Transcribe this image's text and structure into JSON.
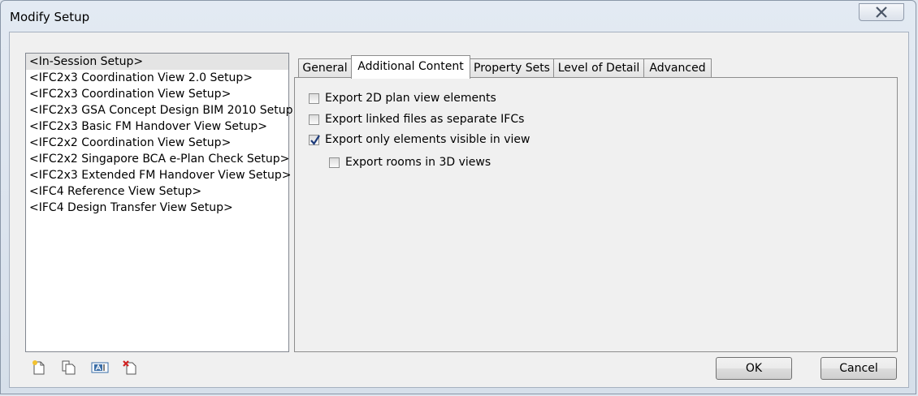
{
  "window": {
    "title": "Modify Setup"
  },
  "setups": [
    "<In-Session Setup>",
    "<IFC2x3 Coordination View 2.0 Setup>",
    "<IFC2x3 Coordination View Setup>",
    "<IFC2x3 GSA Concept Design BIM 2010 Setup>",
    "<IFC2x3 Basic FM Handover View Setup>",
    "<IFC2x2 Coordination View Setup>",
    "<IFC2x2 Singapore BCA e-Plan Check Setup>",
    "<IFC2x3 Extended FM Handover View Setup>",
    "<IFC4 Reference View Setup>",
    "<IFC4 Design Transfer View Setup>"
  ],
  "tabs": [
    {
      "label": "General"
    },
    {
      "label": "Additional Content"
    },
    {
      "label": "Property Sets"
    },
    {
      "label": "Level of Detail"
    },
    {
      "label": "Advanced"
    }
  ],
  "active_tab": "Additional Content",
  "options": [
    {
      "label": "Export 2D plan view elements",
      "checked": false
    },
    {
      "label": "Export linked files as separate IFCs",
      "checked": false
    },
    {
      "label": "Export only elements visible in view",
      "checked": true
    },
    {
      "label": "Export rooms in 3D views",
      "checked": false
    }
  ],
  "toolbar": {
    "icons": [
      "new-setup-icon",
      "duplicate-setup-icon",
      "rename-setup-icon",
      "delete-setup-icon"
    ]
  },
  "buttons": {
    "ok": "OK",
    "cancel": "Cancel"
  },
  "colors": {
    "selected_item_bg": "#e4e4e4",
    "close_x": "#4a5566",
    "check": "#1c3a7a"
  }
}
